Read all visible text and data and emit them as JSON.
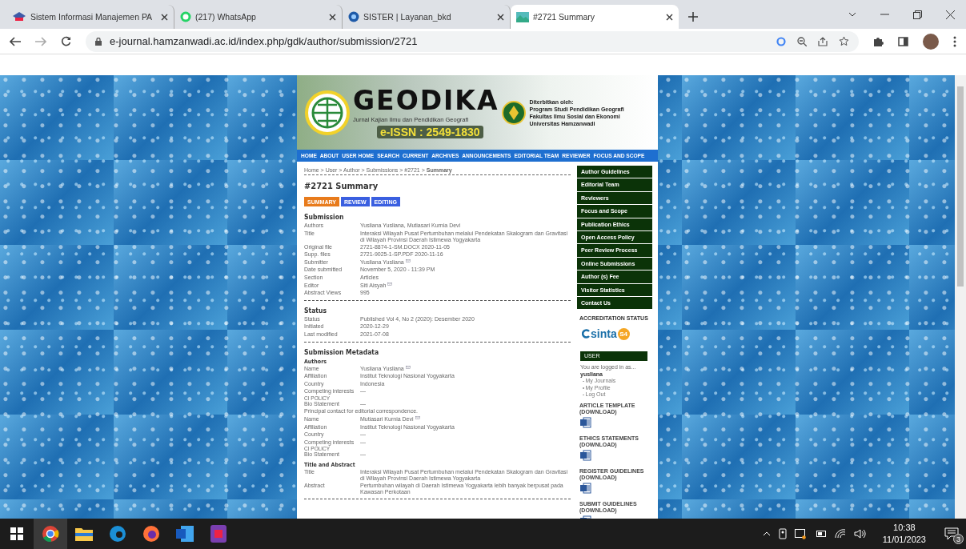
{
  "browser": {
    "tabs": [
      {
        "title": "Sistem Informasi Manajemen PA",
        "selected": false
      },
      {
        "title": "(217) WhatsApp",
        "selected": false
      },
      {
        "title": "SISTER | Layanan_bkd",
        "selected": false
      },
      {
        "title": "#2721 Summary",
        "selected": true
      }
    ],
    "url": "e-journal.hamzanwadi.ac.id/index.php/gdk/author/submission/2721"
  },
  "banner": {
    "title": "GEODIKA",
    "subtitle": "Jurnal Kajian Ilmu dan Pendidikan Geografi",
    "issn": "e-ISSN : 2549-1830",
    "publisher": [
      "Diterbitkan oleh:",
      "Program Studi Pendidikan Geografi",
      "Fakultas Ilmu Sosial dan Ekonomi",
      "Universitas Hamzanwadi"
    ]
  },
  "nav": [
    "HOME",
    "ABOUT",
    "USER HOME",
    "SEARCH",
    "CURRENT",
    "ARCHIVES",
    "ANNOUNCEMENTS",
    "EDITORIAL TEAM",
    "REVIEWER",
    "FOCUS AND SCOPE"
  ],
  "breadcrumb": "Home > User > Author > Submissions > #2721 > **Summary**",
  "heading": "#2721 Summary",
  "page_tabs": [
    {
      "label": "SUMMARY",
      "selected": true
    },
    {
      "label": "REVIEW",
      "selected": false
    },
    {
      "label": "EDITING",
      "selected": false
    }
  ],
  "sections": [
    {
      "title": "Submission",
      "groups": [
        {
          "items": [
            {
              "kind": "row",
              "label": "Authors",
              "value": "Yusliana Yusliana, Mutiasari Kurnia Devi"
            },
            {
              "kind": "row",
              "label": "Title",
              "value": "Interaksi Wilayah Pusat Pertumbuhan melalui Pendekatan Skalogram dan Gravitasi di Wilayah Provinsi Daerah Istimewa Yogyakarta"
            },
            {
              "kind": "row",
              "label": "Original file",
              "value": "2721-8874-1-SM.DOCX  2020-11-05"
            },
            {
              "kind": "row",
              "label": "Supp. files",
              "value": "2721-9025-1-SP.PDF  2020-11-16"
            },
            {
              "kind": "row",
              "label": "Submitter",
              "value": "Yusliana Yusliana",
              "email": true
            },
            {
              "kind": "row",
              "label": "Date submitted",
              "value": "November 5, 2020 - 11:39 PM"
            },
            {
              "kind": "row",
              "label": "Section",
              "value": "Articles"
            },
            {
              "kind": "row",
              "label": "Editor",
              "value": "Siti Aisyah",
              "email": true
            },
            {
              "kind": "row",
              "label": "Abstract Views",
              "value": "995"
            }
          ]
        }
      ]
    },
    {
      "title": "Status",
      "groups": [
        {
          "items": [
            {
              "kind": "row",
              "label": "Status",
              "value": "Published    Vol 4, No 2 (2020): Desember 2020"
            },
            {
              "kind": "row",
              "label": "Initiated",
              "value": "2020-12-29"
            },
            {
              "kind": "row",
              "label": "Last modified",
              "value": "2021-07-08"
            }
          ]
        }
      ]
    },
    {
      "title": "Submission Metadata",
      "groups": [
        {
          "title": "Authors",
          "items": [
            {
              "kind": "row",
              "label": "Name",
              "value": "Yusliana Yusliana",
              "email": true
            },
            {
              "kind": "row",
              "label": "Affiliation",
              "value": "Institut Teknologi Nasional Yogyakarta"
            },
            {
              "kind": "row",
              "label": "Country",
              "value": "Indonesia"
            },
            {
              "kind": "row",
              "label": "Competing interests",
              "sublabel": "CI POLICY",
              "value": "—"
            },
            {
              "kind": "row",
              "label": "Bio Statement",
              "value": "—"
            },
            {
              "kind": "note",
              "value": "Principal contact for editorial correspondence."
            },
            {
              "kind": "row",
              "label": "Name",
              "value": "Mutiasari Kurnia Devi",
              "email": true
            },
            {
              "kind": "row",
              "label": "Affiliation",
              "value": "Institut Teknologi Nasional Yogyakarta"
            },
            {
              "kind": "row",
              "label": "Country",
              "value": "—"
            },
            {
              "kind": "row",
              "label": "Competing interests",
              "sublabel": "CI POLICY",
              "value": "—"
            },
            {
              "kind": "row",
              "label": "Bio Statement",
              "value": "—"
            }
          ]
        },
        {
          "title": "Title and Abstract",
          "items": [
            {
              "kind": "row",
              "label": "Title",
              "value": "Interaksi Wilayah Pusat Pertumbuhan melalui Pendekatan Skalogram dan Gravitasi di Wilayah Provinsi Daerah Istimewa Yogyakarta"
            },
            {
              "kind": "row",
              "label": "Abstract",
              "value": "Pertumbuhan wilayah di Daerah Istimewa Yogyakarta lebih banyak berpusat pada Kawasan Perkotaan"
            }
          ]
        }
      ]
    }
  ],
  "sidebar": {
    "menu": [
      "Author Guidelines",
      "Editorial Team",
      "Reviewers",
      "Focus and Scope",
      "Publication Ethics",
      "Open Access Policy",
      "Peer Review Process",
      "Online Submissions",
      "Author (s) Fee",
      "Visitor Statistics",
      "Contact Us"
    ],
    "accreditation_title": "ACCREDITATION STATUS",
    "sinta": "sinta",
    "sinta_grade": "S4",
    "user": {
      "title": "USER",
      "logged_in": "You are logged in as...",
      "username": "yusliana",
      "links": [
        "My Journals",
        "My Profile",
        "Log Out"
      ]
    },
    "downloads": [
      "ARTICLE TEMPLATE (DOWNLOAD)",
      "ETHICS STATEMENTS (DOWNLOAD)",
      "REGISTER GUIDELINES (DOWNLOAD)",
      "SUBMIT GUIDELINES (DOWNLOAD)"
    ]
  },
  "taskbar": {
    "time": "10:38",
    "date": "11/01/2023",
    "notifications": "3"
  }
}
